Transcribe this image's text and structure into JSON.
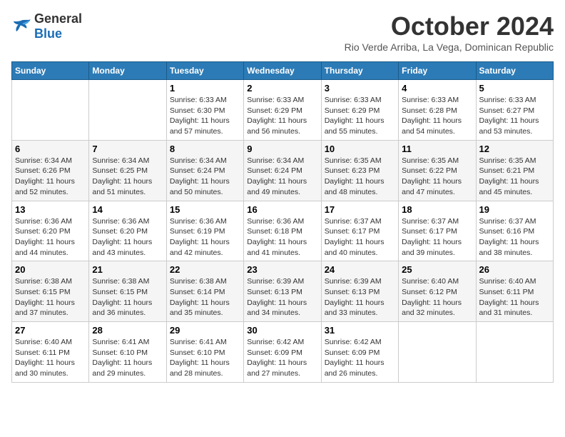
{
  "header": {
    "logo_general": "General",
    "logo_blue": "Blue",
    "month_title": "October 2024",
    "subtitle": "Rio Verde Arriba, La Vega, Dominican Republic"
  },
  "columns": [
    "Sunday",
    "Monday",
    "Tuesday",
    "Wednesday",
    "Thursday",
    "Friday",
    "Saturday"
  ],
  "weeks": [
    [
      {
        "num": "",
        "details": ""
      },
      {
        "num": "",
        "details": ""
      },
      {
        "num": "1",
        "details": "Sunrise: 6:33 AM\nSunset: 6:30 PM\nDaylight: 11 hours\nand 57 minutes."
      },
      {
        "num": "2",
        "details": "Sunrise: 6:33 AM\nSunset: 6:29 PM\nDaylight: 11 hours\nand 56 minutes."
      },
      {
        "num": "3",
        "details": "Sunrise: 6:33 AM\nSunset: 6:29 PM\nDaylight: 11 hours\nand 55 minutes."
      },
      {
        "num": "4",
        "details": "Sunrise: 6:33 AM\nSunset: 6:28 PM\nDaylight: 11 hours\nand 54 minutes."
      },
      {
        "num": "5",
        "details": "Sunrise: 6:33 AM\nSunset: 6:27 PM\nDaylight: 11 hours\nand 53 minutes."
      }
    ],
    [
      {
        "num": "6",
        "details": "Sunrise: 6:34 AM\nSunset: 6:26 PM\nDaylight: 11 hours\nand 52 minutes."
      },
      {
        "num": "7",
        "details": "Sunrise: 6:34 AM\nSunset: 6:25 PM\nDaylight: 11 hours\nand 51 minutes."
      },
      {
        "num": "8",
        "details": "Sunrise: 6:34 AM\nSunset: 6:24 PM\nDaylight: 11 hours\nand 50 minutes."
      },
      {
        "num": "9",
        "details": "Sunrise: 6:34 AM\nSunset: 6:24 PM\nDaylight: 11 hours\nand 49 minutes."
      },
      {
        "num": "10",
        "details": "Sunrise: 6:35 AM\nSunset: 6:23 PM\nDaylight: 11 hours\nand 48 minutes."
      },
      {
        "num": "11",
        "details": "Sunrise: 6:35 AM\nSunset: 6:22 PM\nDaylight: 11 hours\nand 47 minutes."
      },
      {
        "num": "12",
        "details": "Sunrise: 6:35 AM\nSunset: 6:21 PM\nDaylight: 11 hours\nand 45 minutes."
      }
    ],
    [
      {
        "num": "13",
        "details": "Sunrise: 6:36 AM\nSunset: 6:20 PM\nDaylight: 11 hours\nand 44 minutes."
      },
      {
        "num": "14",
        "details": "Sunrise: 6:36 AM\nSunset: 6:20 PM\nDaylight: 11 hours\nand 43 minutes."
      },
      {
        "num": "15",
        "details": "Sunrise: 6:36 AM\nSunset: 6:19 PM\nDaylight: 11 hours\nand 42 minutes."
      },
      {
        "num": "16",
        "details": "Sunrise: 6:36 AM\nSunset: 6:18 PM\nDaylight: 11 hours\nand 41 minutes."
      },
      {
        "num": "17",
        "details": "Sunrise: 6:37 AM\nSunset: 6:17 PM\nDaylight: 11 hours\nand 40 minutes."
      },
      {
        "num": "18",
        "details": "Sunrise: 6:37 AM\nSunset: 6:17 PM\nDaylight: 11 hours\nand 39 minutes."
      },
      {
        "num": "19",
        "details": "Sunrise: 6:37 AM\nSunset: 6:16 PM\nDaylight: 11 hours\nand 38 minutes."
      }
    ],
    [
      {
        "num": "20",
        "details": "Sunrise: 6:38 AM\nSunset: 6:15 PM\nDaylight: 11 hours\nand 37 minutes."
      },
      {
        "num": "21",
        "details": "Sunrise: 6:38 AM\nSunset: 6:15 PM\nDaylight: 11 hours\nand 36 minutes."
      },
      {
        "num": "22",
        "details": "Sunrise: 6:38 AM\nSunset: 6:14 PM\nDaylight: 11 hours\nand 35 minutes."
      },
      {
        "num": "23",
        "details": "Sunrise: 6:39 AM\nSunset: 6:13 PM\nDaylight: 11 hours\nand 34 minutes."
      },
      {
        "num": "24",
        "details": "Sunrise: 6:39 AM\nSunset: 6:13 PM\nDaylight: 11 hours\nand 33 minutes."
      },
      {
        "num": "25",
        "details": "Sunrise: 6:40 AM\nSunset: 6:12 PM\nDaylight: 11 hours\nand 32 minutes."
      },
      {
        "num": "26",
        "details": "Sunrise: 6:40 AM\nSunset: 6:11 PM\nDaylight: 11 hours\nand 31 minutes."
      }
    ],
    [
      {
        "num": "27",
        "details": "Sunrise: 6:40 AM\nSunset: 6:11 PM\nDaylight: 11 hours\nand 30 minutes."
      },
      {
        "num": "28",
        "details": "Sunrise: 6:41 AM\nSunset: 6:10 PM\nDaylight: 11 hours\nand 29 minutes."
      },
      {
        "num": "29",
        "details": "Sunrise: 6:41 AM\nSunset: 6:10 PM\nDaylight: 11 hours\nand 28 minutes."
      },
      {
        "num": "30",
        "details": "Sunrise: 6:42 AM\nSunset: 6:09 PM\nDaylight: 11 hours\nand 27 minutes."
      },
      {
        "num": "31",
        "details": "Sunrise: 6:42 AM\nSunset: 6:09 PM\nDaylight: 11 hours\nand 26 minutes."
      },
      {
        "num": "",
        "details": ""
      },
      {
        "num": "",
        "details": ""
      }
    ]
  ]
}
